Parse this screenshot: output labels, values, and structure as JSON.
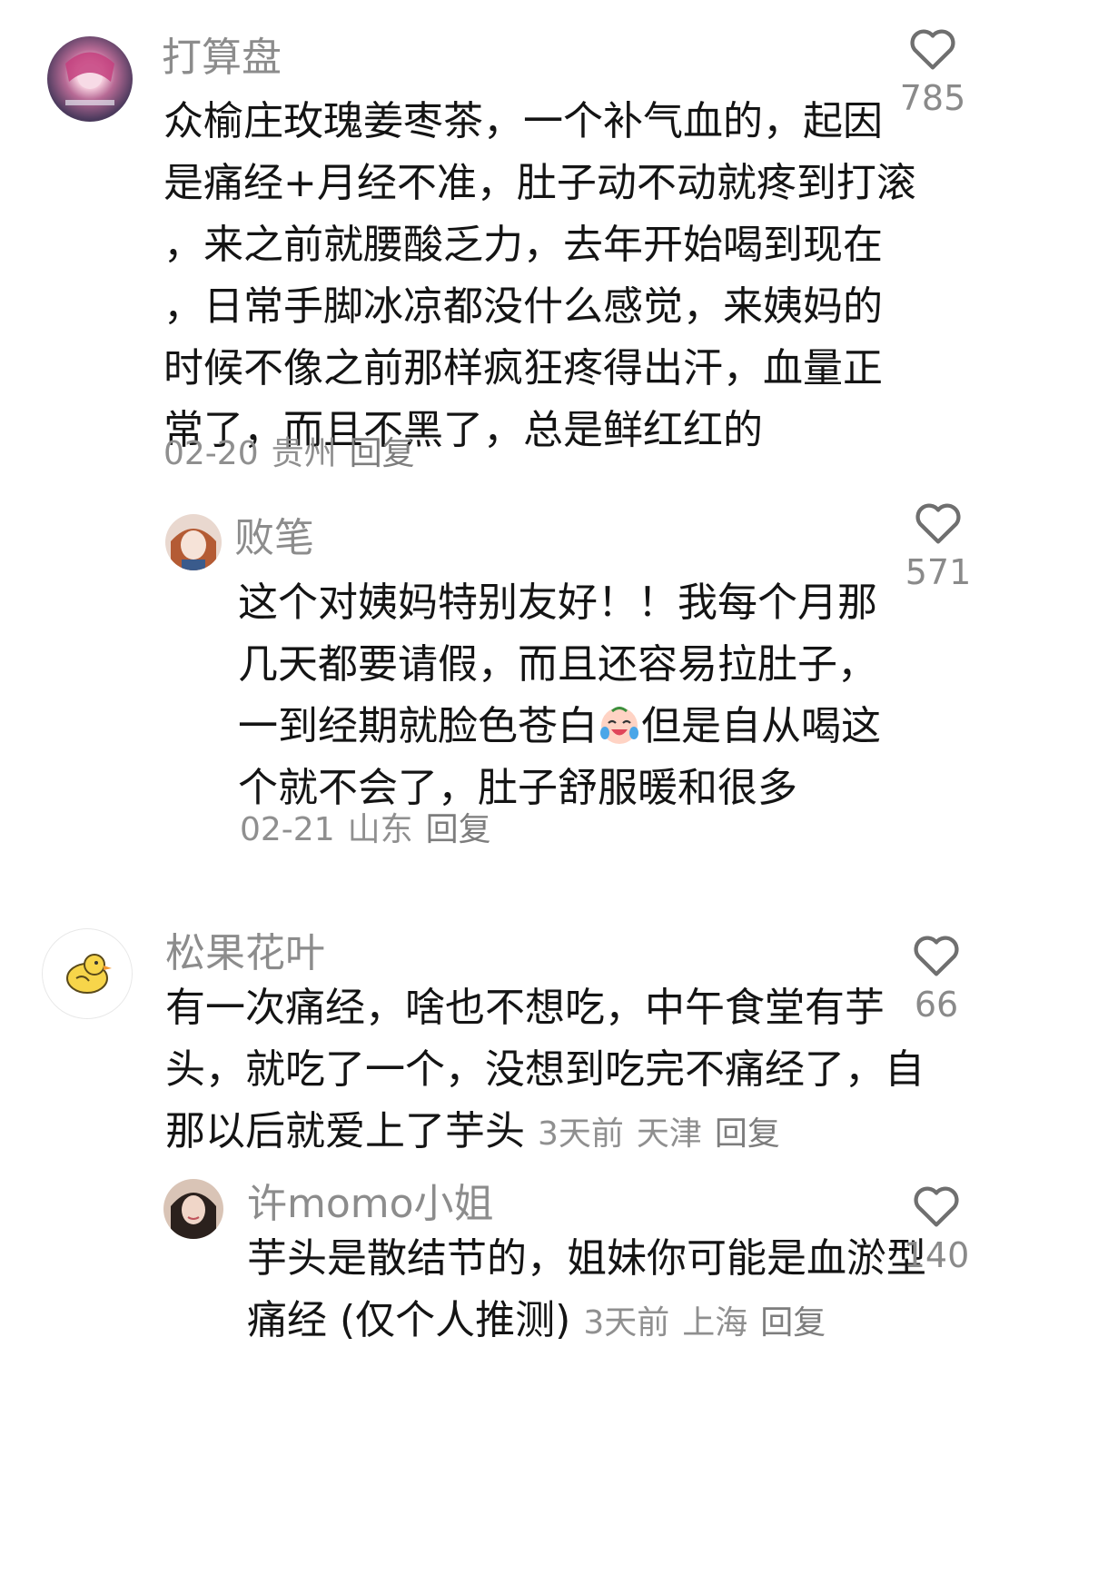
{
  "comments": [
    {
      "username": "打算盘",
      "lines": [
        "众榆庄玫瑰姜枣茶，一个补气血的，起因",
        "是痛经+月经不准，肚子动不动就疼到打滚",
        "，来之前就腰酸乏力，去年开始喝到现在",
        "，日常手脚冰凉都没什么感觉，来姨妈的",
        "时候不像之前那样疯狂疼得出汗，血量正",
        "常了，而且不黑了，总是鲜红红的"
      ],
      "date": "02-20",
      "location": "贵州",
      "reply": "回复",
      "likes": "785"
    },
    {
      "username": "败笔",
      "lines": [
        "这个对姨妈特别友好！！我每个月那",
        "几天都要请假，而且还容易拉肚子，",
        "一到经期就脸色苍白",
        "个就不会了，肚子舒服暖和很多"
      ],
      "line3_after_emoji": "但是自从喝这",
      "emoji": "crying-laughing-face",
      "date": "02-21",
      "location": "山东",
      "reply": "回复",
      "likes": "571"
    },
    {
      "username": "松果花叶",
      "lines": [
        "有一次痛经，啥也不想吃，中午食堂有芋",
        "头，就吃了一个，没想到吃完不痛经了，自",
        "那以后就爱上了芋头"
      ],
      "date": "3天前",
      "location": "天津",
      "reply": "回复",
      "likes": "66"
    },
    {
      "username": "许momo小姐",
      "lines": [
        "芋头是散结节的，姐妹你可能是血淤型",
        "痛经 (仅个人推测)"
      ],
      "date": "3天前",
      "location": "上海",
      "reply": "回复",
      "likes": "140"
    }
  ]
}
